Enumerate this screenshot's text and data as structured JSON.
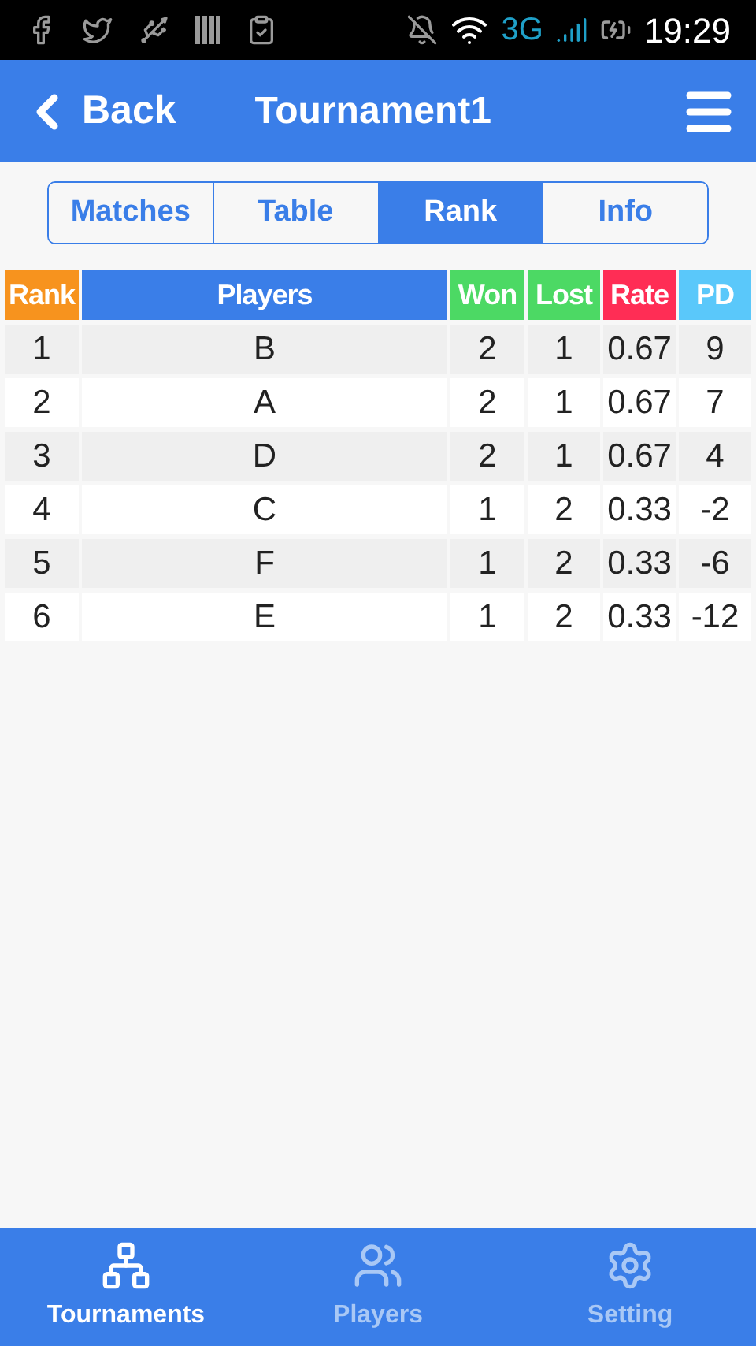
{
  "status_bar": {
    "network": "3G",
    "time": "19:29"
  },
  "header": {
    "back": "Back",
    "title": "Tournament1"
  },
  "tabs": [
    {
      "label": "Matches",
      "selected": false
    },
    {
      "label": "Table",
      "selected": false
    },
    {
      "label": "Rank",
      "selected": true
    },
    {
      "label": "Info",
      "selected": false
    }
  ],
  "table": {
    "columns": [
      {
        "label": "Rank",
        "color": "#f7931e"
      },
      {
        "label": "Players",
        "color": "#3a7ee8"
      },
      {
        "label": "Won",
        "color": "#4cd964"
      },
      {
        "label": "Lost",
        "color": "#4cd964"
      },
      {
        "label": "Rate",
        "color": "#ff2d55"
      },
      {
        "label": "PD",
        "color": "#5ac8fa"
      }
    ],
    "rows": [
      [
        "1",
        "B",
        "2",
        "1",
        "0.67",
        "9"
      ],
      [
        "2",
        "A",
        "2",
        "1",
        "0.67",
        "7"
      ],
      [
        "3",
        "D",
        "2",
        "1",
        "0.67",
        "4"
      ],
      [
        "4",
        "C",
        "1",
        "2",
        "0.33",
        "-2"
      ],
      [
        "5",
        "F",
        "1",
        "2",
        "0.33",
        "-6"
      ],
      [
        "6",
        "E",
        "1",
        "2",
        "0.33",
        "-12"
      ]
    ]
  },
  "bottom_nav": [
    {
      "label": "Tournaments",
      "kind": "tree",
      "selected": true
    },
    {
      "label": "Players",
      "kind": "people",
      "selected": false
    },
    {
      "label": "Setting",
      "kind": "gear",
      "selected": false
    }
  ]
}
